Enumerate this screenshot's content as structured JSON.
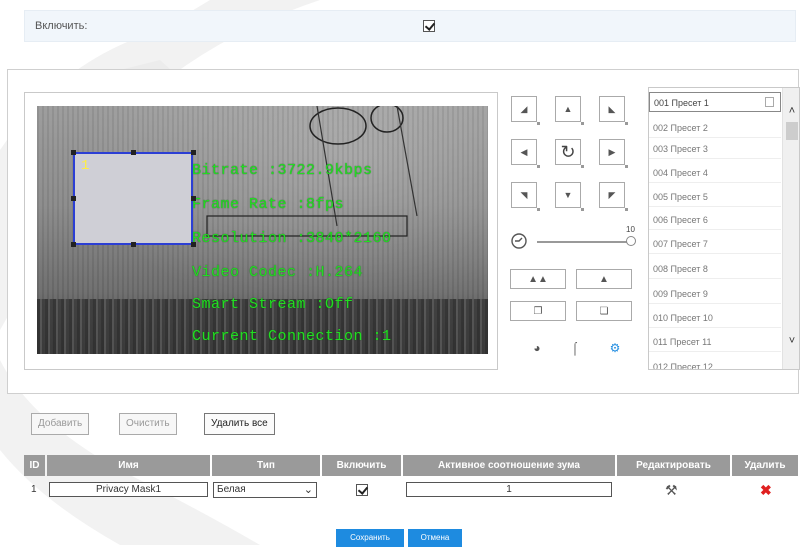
{
  "enable_row": {
    "label": "Включить:",
    "checked": true
  },
  "video": {
    "osd": [
      "Bitrate :3722.9kbps",
      "Frame Rate :8fps",
      "Resolution :3840*2160",
      "Video Codec :H.264",
      "Smart Stream :Off",
      "Current Connection :1"
    ],
    "mask_number": "1"
  },
  "ptz": {
    "direction_icons": [
      "up-left-arrow-icon",
      "up-arrow-icon",
      "up-right-arrow-icon",
      "left-arrow-icon",
      "rotate-icon",
      "right-arrow-icon",
      "down-left-arrow-icon",
      "down-arrow-icon",
      "down-right-arrow-icon"
    ],
    "slider_max": "10",
    "zoom_icons": [
      "zoom-out-icon",
      "zoom-in-icon",
      "focus-near-icon",
      "focus-far-icon"
    ],
    "bottom_icons": [
      "timer-icon",
      "crop-icon",
      "settings-icon"
    ]
  },
  "presets": [
    "001 Пресет 1",
    "002 Пресет 2",
    "003 Пресет 3",
    "004 Пресет 4",
    "005 Пресет 5",
    "006 Пресет 6",
    "007 Пресет 7",
    "008 Пресет 8",
    "009 Пресет 9",
    "010 Пресет 10",
    "011 Пресет 11",
    "012 Пресет 12"
  ],
  "buttons": {
    "add": "Добавить",
    "clear": "Очистить",
    "delete_all": "Удалить все"
  },
  "table": {
    "headers": [
      "ID",
      "Имя",
      "Тип",
      "Включить",
      "Активное соотношение зума",
      "Редактировать",
      "Удалить"
    ],
    "rows": [
      {
        "id": "1",
        "name": "Privacy Mask1",
        "type": "Белая",
        "enabled": true,
        "zoom_ratio": "1"
      }
    ]
  },
  "footer": {
    "save": "Сохранить",
    "cancel": "Отмена"
  },
  "colors": {
    "accent": "#1e8be0",
    "mask_border": "#2c3fd4",
    "osd_text": "#22dd22",
    "delete": "#e02020"
  }
}
